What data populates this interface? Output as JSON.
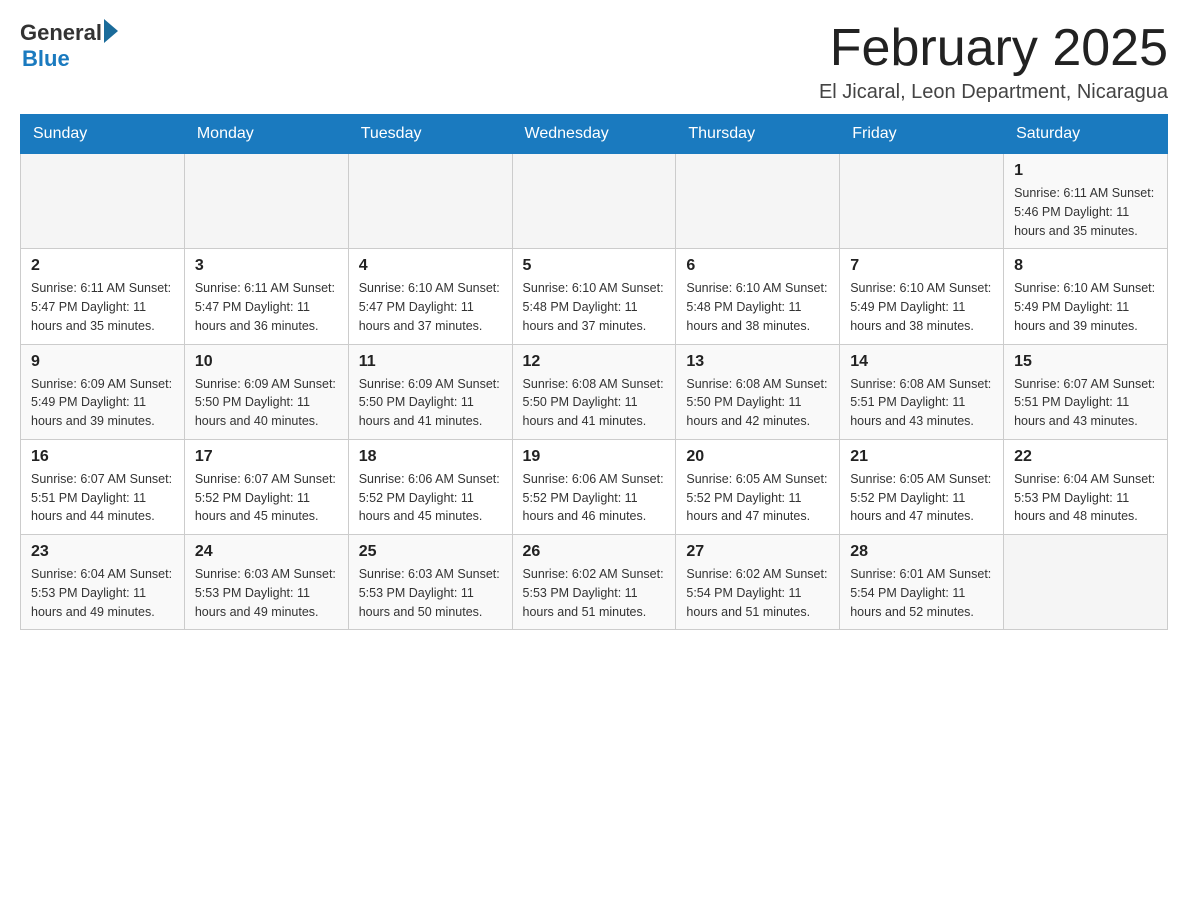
{
  "header": {
    "title": "February 2025",
    "location": "El Jicaral, Leon Department, Nicaragua",
    "logo_general": "General",
    "logo_blue": "Blue"
  },
  "days_of_week": [
    "Sunday",
    "Monday",
    "Tuesday",
    "Wednesday",
    "Thursday",
    "Friday",
    "Saturday"
  ],
  "weeks": [
    {
      "days": [
        {
          "number": "",
          "info": ""
        },
        {
          "number": "",
          "info": ""
        },
        {
          "number": "",
          "info": ""
        },
        {
          "number": "",
          "info": ""
        },
        {
          "number": "",
          "info": ""
        },
        {
          "number": "",
          "info": ""
        },
        {
          "number": "1",
          "info": "Sunrise: 6:11 AM\nSunset: 5:46 PM\nDaylight: 11 hours and 35 minutes."
        }
      ]
    },
    {
      "days": [
        {
          "number": "2",
          "info": "Sunrise: 6:11 AM\nSunset: 5:47 PM\nDaylight: 11 hours and 35 minutes."
        },
        {
          "number": "3",
          "info": "Sunrise: 6:11 AM\nSunset: 5:47 PM\nDaylight: 11 hours and 36 minutes."
        },
        {
          "number": "4",
          "info": "Sunrise: 6:10 AM\nSunset: 5:47 PM\nDaylight: 11 hours and 37 minutes."
        },
        {
          "number": "5",
          "info": "Sunrise: 6:10 AM\nSunset: 5:48 PM\nDaylight: 11 hours and 37 minutes."
        },
        {
          "number": "6",
          "info": "Sunrise: 6:10 AM\nSunset: 5:48 PM\nDaylight: 11 hours and 38 minutes."
        },
        {
          "number": "7",
          "info": "Sunrise: 6:10 AM\nSunset: 5:49 PM\nDaylight: 11 hours and 38 minutes."
        },
        {
          "number": "8",
          "info": "Sunrise: 6:10 AM\nSunset: 5:49 PM\nDaylight: 11 hours and 39 minutes."
        }
      ]
    },
    {
      "days": [
        {
          "number": "9",
          "info": "Sunrise: 6:09 AM\nSunset: 5:49 PM\nDaylight: 11 hours and 39 minutes."
        },
        {
          "number": "10",
          "info": "Sunrise: 6:09 AM\nSunset: 5:50 PM\nDaylight: 11 hours and 40 minutes."
        },
        {
          "number": "11",
          "info": "Sunrise: 6:09 AM\nSunset: 5:50 PM\nDaylight: 11 hours and 41 minutes."
        },
        {
          "number": "12",
          "info": "Sunrise: 6:08 AM\nSunset: 5:50 PM\nDaylight: 11 hours and 41 minutes."
        },
        {
          "number": "13",
          "info": "Sunrise: 6:08 AM\nSunset: 5:50 PM\nDaylight: 11 hours and 42 minutes."
        },
        {
          "number": "14",
          "info": "Sunrise: 6:08 AM\nSunset: 5:51 PM\nDaylight: 11 hours and 43 minutes."
        },
        {
          "number": "15",
          "info": "Sunrise: 6:07 AM\nSunset: 5:51 PM\nDaylight: 11 hours and 43 minutes."
        }
      ]
    },
    {
      "days": [
        {
          "number": "16",
          "info": "Sunrise: 6:07 AM\nSunset: 5:51 PM\nDaylight: 11 hours and 44 minutes."
        },
        {
          "number": "17",
          "info": "Sunrise: 6:07 AM\nSunset: 5:52 PM\nDaylight: 11 hours and 45 minutes."
        },
        {
          "number": "18",
          "info": "Sunrise: 6:06 AM\nSunset: 5:52 PM\nDaylight: 11 hours and 45 minutes."
        },
        {
          "number": "19",
          "info": "Sunrise: 6:06 AM\nSunset: 5:52 PM\nDaylight: 11 hours and 46 minutes."
        },
        {
          "number": "20",
          "info": "Sunrise: 6:05 AM\nSunset: 5:52 PM\nDaylight: 11 hours and 47 minutes."
        },
        {
          "number": "21",
          "info": "Sunrise: 6:05 AM\nSunset: 5:52 PM\nDaylight: 11 hours and 47 minutes."
        },
        {
          "number": "22",
          "info": "Sunrise: 6:04 AM\nSunset: 5:53 PM\nDaylight: 11 hours and 48 minutes."
        }
      ]
    },
    {
      "days": [
        {
          "number": "23",
          "info": "Sunrise: 6:04 AM\nSunset: 5:53 PM\nDaylight: 11 hours and 49 minutes."
        },
        {
          "number": "24",
          "info": "Sunrise: 6:03 AM\nSunset: 5:53 PM\nDaylight: 11 hours and 49 minutes."
        },
        {
          "number": "25",
          "info": "Sunrise: 6:03 AM\nSunset: 5:53 PM\nDaylight: 11 hours and 50 minutes."
        },
        {
          "number": "26",
          "info": "Sunrise: 6:02 AM\nSunset: 5:53 PM\nDaylight: 11 hours and 51 minutes."
        },
        {
          "number": "27",
          "info": "Sunrise: 6:02 AM\nSunset: 5:54 PM\nDaylight: 11 hours and 51 minutes."
        },
        {
          "number": "28",
          "info": "Sunrise: 6:01 AM\nSunset: 5:54 PM\nDaylight: 11 hours and 52 minutes."
        },
        {
          "number": "",
          "info": ""
        }
      ]
    }
  ]
}
